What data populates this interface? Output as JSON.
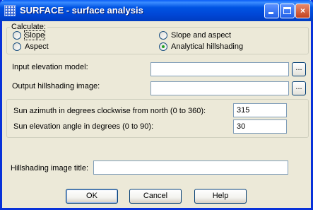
{
  "window": {
    "title": "SURFACE - surface analysis",
    "controls": {
      "minimize": "minimize",
      "maximize": "maximize",
      "close": "×"
    }
  },
  "calculate": {
    "legend": "Calculate:",
    "options": [
      {
        "label": "Slope",
        "checked": false
      },
      {
        "label": "Slope and aspect",
        "checked": false
      },
      {
        "label": "Aspect",
        "checked": false
      },
      {
        "label": "Analytical hillshading",
        "checked": true
      }
    ]
  },
  "files": {
    "input_label": "Input elevation model:",
    "input_value": "",
    "output_label": "Output hillshading image:",
    "output_value": "",
    "browse_label": "..."
  },
  "sun": {
    "azimuth_label": "Sun azimuth in degrees clockwise from north (0 to 360):",
    "azimuth_value": "315",
    "elevation_label": "Sun elevation angle in degrees (0 to 90):",
    "elevation_value": "30"
  },
  "title_field": {
    "label": "Hillshading image title:",
    "value": ""
  },
  "buttons": {
    "ok": "OK",
    "cancel": "Cancel",
    "help": "Help"
  }
}
